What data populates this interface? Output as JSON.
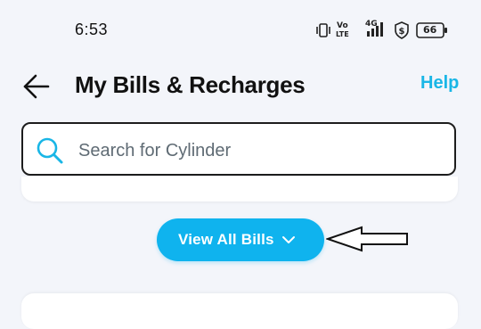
{
  "status_bar": {
    "time": "6:53",
    "network_badge_top": "Vo",
    "network_badge_bottom": "LTE",
    "network_type": "4G",
    "battery_level": "66",
    "icons": [
      "vibrate-icon",
      "volte-icon",
      "signal-4g-icon",
      "shield-dollar-icon",
      "battery-icon"
    ]
  },
  "header": {
    "title": "My Bills & Recharges",
    "help_label": "Help",
    "back_icon": "arrow-left-icon"
  },
  "search": {
    "placeholder": "Search for Cylinder",
    "value": "",
    "icon": "search-icon"
  },
  "bills": {
    "view_all_label": "View All Bills",
    "chevron_icon": "chevron-down-icon"
  },
  "colors": {
    "accent": "#0fb3ee",
    "help_link": "#19b6e6",
    "background": "#f3f5fa",
    "card": "#ffffff",
    "text": "#111111"
  }
}
